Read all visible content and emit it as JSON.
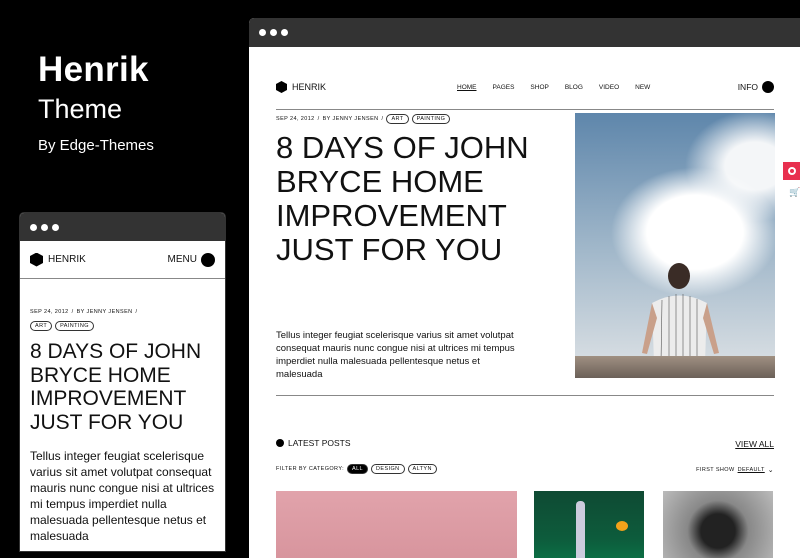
{
  "brand": {
    "name": "Henrik",
    "subtitle": "Theme",
    "by": "By Edge-Themes"
  },
  "site": {
    "logo": "HENRIK",
    "menu": [
      "HOME",
      "PAGES",
      "SHOP",
      "BLOG",
      "VIDEO",
      "NEW"
    ],
    "info": "INFO",
    "mobile_menu": "MENU"
  },
  "post": {
    "date": "SEP 24, 2012",
    "sep": "/",
    "author": "BY JENNY JENSEN",
    "tags": [
      "ART",
      "PAINTING"
    ],
    "title": "8 DAYS OF JOHN BRYCE HOME IMPROVEMENT JUST FOR YOU",
    "excerpt": "Tellus integer feugiat scelerisque varius sit amet volutpat consequat mauris nunc congue nisi at ultrices mi tempus imperdiet nulla malesuada pellentesque netus et malesuada"
  },
  "latest": {
    "heading": "LATEST POSTS",
    "view_all": "VIEW ALL",
    "filter_label": "FILTER BY CATEGORY:",
    "filters": [
      "ALL",
      "DESIGN",
      "ALTYN"
    ],
    "sort_label": "FIRST SHOW",
    "sort_value": "DEFAULT"
  },
  "colors": {
    "accent": "#e8304f"
  }
}
